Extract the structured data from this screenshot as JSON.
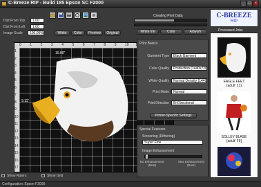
{
  "window": {
    "title": "C-Breeze RIP  -  Build 185 Epson SC F2000",
    "minimize": "_",
    "maximize": "□",
    "close": "×"
  },
  "left": {
    "dist_top_label": "Dist From Top",
    "dist_top_value": "1.00",
    "dist_left_label": "Dist From Left",
    "dist_left_value": "1.00",
    "scale_label": "Image Scale",
    "scale_value": "100.00%"
  },
  "buttons": {
    "white": "White",
    "color": "Color",
    "preview": "Preview",
    "original": "Original"
  },
  "status": {
    "label": "Creating Print Data",
    "progress": 0.55
  },
  "logo": {
    "text": "C-BREEZE",
    "subtext": "RIP"
  },
  "tabs": [
    "White Ink",
    "Color",
    "Artwork"
  ],
  "print_basics": {
    "title": "Print Basics",
    "garment_type_label": "Garment Type",
    "garment_type_value": "Black Garment",
    "color_quality_label": "Color Quality",
    "color_quality_value": "Production (1440x720)",
    "white_quality_label": "White Quality",
    "white_quality_value": "Normal Density (1440x1440)",
    "print_mode_label": "Print Mode",
    "print_mode_value": "Normal",
    "print_direction_label": "Print Direction",
    "print_direction_value": "Bi-Directional",
    "printer_settings_button": "Printer-Specific Settings"
  },
  "special": {
    "title": "Special Features",
    "screening_label": "Screening (Dithering)",
    "screening_value": "Super Fine",
    "enhancement_label": "Image Enhancement",
    "no_enh": "No Enhancement (Best)",
    "max_enh": "Max Enhancement (Best)"
  },
  "queue": {
    "title": "Processed Jobs",
    "items": [
      {
        "name": "EAGLE FEET",
        "sub": "[adult' L1]"
      },
      {
        "name": "SOLLEY BLASE",
        "sub": "[adult' F5]"
      }
    ]
  },
  "rulers": {
    "top": [
      "0",
      "1",
      "2",
      "3",
      "4",
      "5",
      "6",
      "7",
      "8",
      "9",
      "10",
      "11",
      "12",
      "13",
      "14"
    ],
    "left": [
      "1",
      "2",
      "3",
      "4",
      "5",
      "6",
      "7",
      "8",
      "9",
      "10",
      "11",
      "12",
      "13",
      "14",
      "15",
      "16",
      "17"
    ]
  },
  "canvas": {
    "dim_top": "10.00\"",
    "dim_side": "9.11\""
  },
  "bottom": {
    "show_rulers": "Show Rulers",
    "show_grid": "Show Grid",
    "config": "Configuration: Epson F2000"
  }
}
